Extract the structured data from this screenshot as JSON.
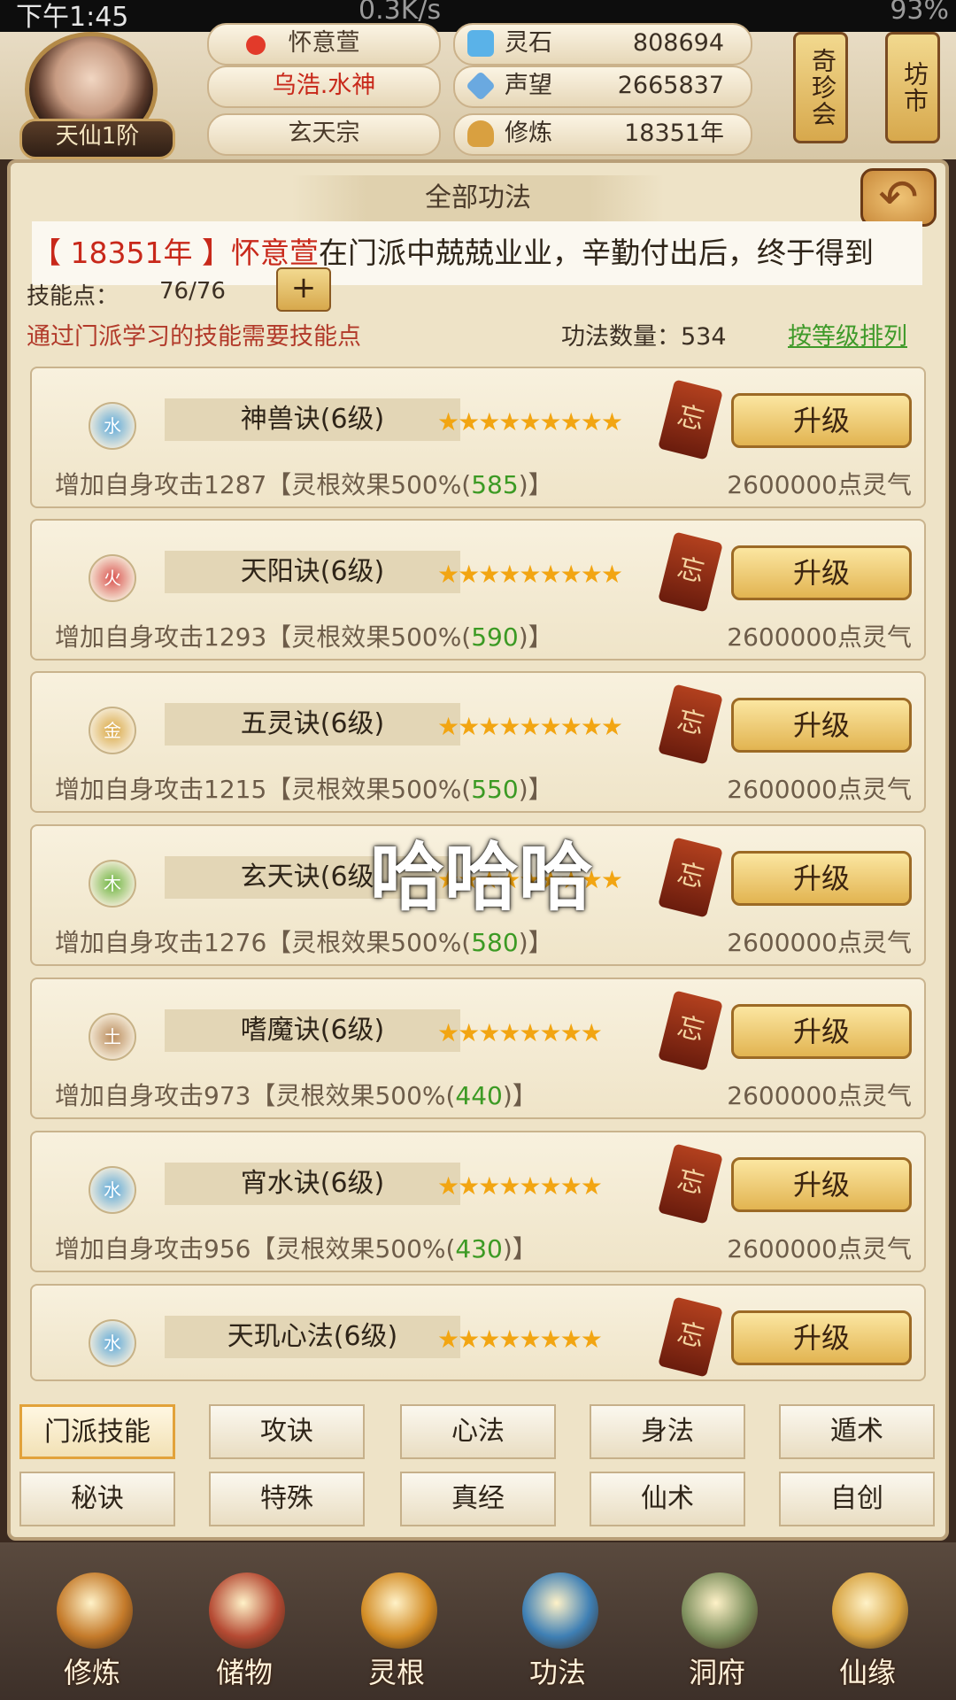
{
  "status_bar": {
    "time": "下午1:45",
    "speed": "0.3K/s",
    "battery": "93%"
  },
  "player": {
    "rank": "天仙1阶",
    "pill1": "怀意萱",
    "pill2": "乌浩.水神",
    "pill3": "玄天宗",
    "resources": [
      {
        "label": "灵石",
        "value": "808694",
        "icon": "spirit-stone-icon",
        "color": "#5ab2e8"
      },
      {
        "label": "声望",
        "value": "2665837",
        "icon": "crystal-icon",
        "color": "#6aa9e0"
      },
      {
        "label": "修炼",
        "value": "18351年",
        "icon": "meditation-icon",
        "color": "#d9a040"
      }
    ],
    "side_buttons": [
      "奇珍会",
      "坊市"
    ]
  },
  "panel": {
    "title": "全部功法",
    "ticker": {
      "year": "【 18351年 】",
      "name": "怀意萱",
      "text": "在门派中兢兢业业，辛勤付出后，终于得到"
    },
    "skill_points_label": "技能点：",
    "skill_points_value": "76/76",
    "add_label": "+",
    "hint": "通过门派学习的技能需要技能点",
    "count": "功法数量：534",
    "sort": "按等级排列"
  },
  "skills": [
    {
      "element": "水",
      "elem_color": "#5aa7d8",
      "name": "神兽诀(6级)",
      "stars": "★★★★★★★★★",
      "effect": "增加自身攻击1287【灵根效果500%(",
      "effect_val": "585",
      "effect_end": ")】",
      "cost": "2600000点灵气",
      "tag": "忘",
      "upgrade": "升级"
    },
    {
      "element": "火",
      "elem_color": "#d9534f",
      "name": "天阳诀(6级)",
      "stars": "★★★★★★★★★",
      "effect": "增加自身攻击1293【灵根效果500%(",
      "effect_val": "590",
      "effect_end": ")】",
      "cost": "2600000点灵气",
      "tag": "忘",
      "upgrade": "升级"
    },
    {
      "element": "金",
      "elem_color": "#d9a640",
      "name": "五灵诀(6级)",
      "stars": "★★★★★★★★★",
      "effect": "增加自身攻击1215【灵根效果500%(",
      "effect_val": "550",
      "effect_end": ")】",
      "cost": "2600000点灵气",
      "tag": "忘",
      "upgrade": "升级"
    },
    {
      "element": "木",
      "elem_color": "#6bb33d",
      "name": "玄天诀(6级)",
      "stars": "★★★★★★★★★",
      "effect": "增加自身攻击1276【灵根效果500%(",
      "effect_val": "580",
      "effect_end": ")】",
      "cost": "2600000点灵气",
      "tag": "忘",
      "upgrade": "升级"
    },
    {
      "element": "土",
      "elem_color": "#b98a5a",
      "name": "嗜魔诀(6级)",
      "stars": "★★★★★★★★",
      "effect": "增加自身攻击973【灵根效果500%(",
      "effect_val": "440",
      "effect_end": ")】",
      "cost": "2600000点灵气",
      "tag": "忘",
      "upgrade": "升级"
    },
    {
      "element": "水",
      "elem_color": "#5aa7d8",
      "name": "宵水诀(6级)",
      "stars": "★★★★★★★★",
      "effect": "增加自身攻击956【灵根效果500%(",
      "effect_val": "430",
      "effect_end": ")】",
      "cost": "2600000点灵气",
      "tag": "忘",
      "upgrade": "升级"
    },
    {
      "element": "水",
      "elem_color": "#5aa7d8",
      "name": "天玑心法(6级)",
      "stars": "★★★★★★★★",
      "effect": "",
      "effect_val": "",
      "effect_end": "",
      "cost": "",
      "tag": "忘",
      "upgrade": "升级"
    }
  ],
  "overlay": "哈哈哈",
  "tabs_row1": [
    "门派技能",
    "攻诀",
    "心法",
    "身法",
    "遁术"
  ],
  "tabs_row2": [
    "秘诀",
    "特殊",
    "真经",
    "仙术",
    "自创"
  ],
  "bottom_nav": [
    {
      "label": "修炼",
      "icon": "monk-icon",
      "color": "#c47a2a"
    },
    {
      "label": "储物",
      "icon": "bag-icon",
      "color": "#b54a33"
    },
    {
      "label": "灵根",
      "icon": "triskele-icon",
      "color": "#d28b24"
    },
    {
      "label": "功法",
      "icon": "book-icon",
      "color": "#3e7fb4"
    },
    {
      "label": "洞府",
      "icon": "house-icon",
      "color": "#7c8e5c"
    },
    {
      "label": "仙缘",
      "icon": "gourd-icon",
      "color": "#d7a340"
    }
  ]
}
